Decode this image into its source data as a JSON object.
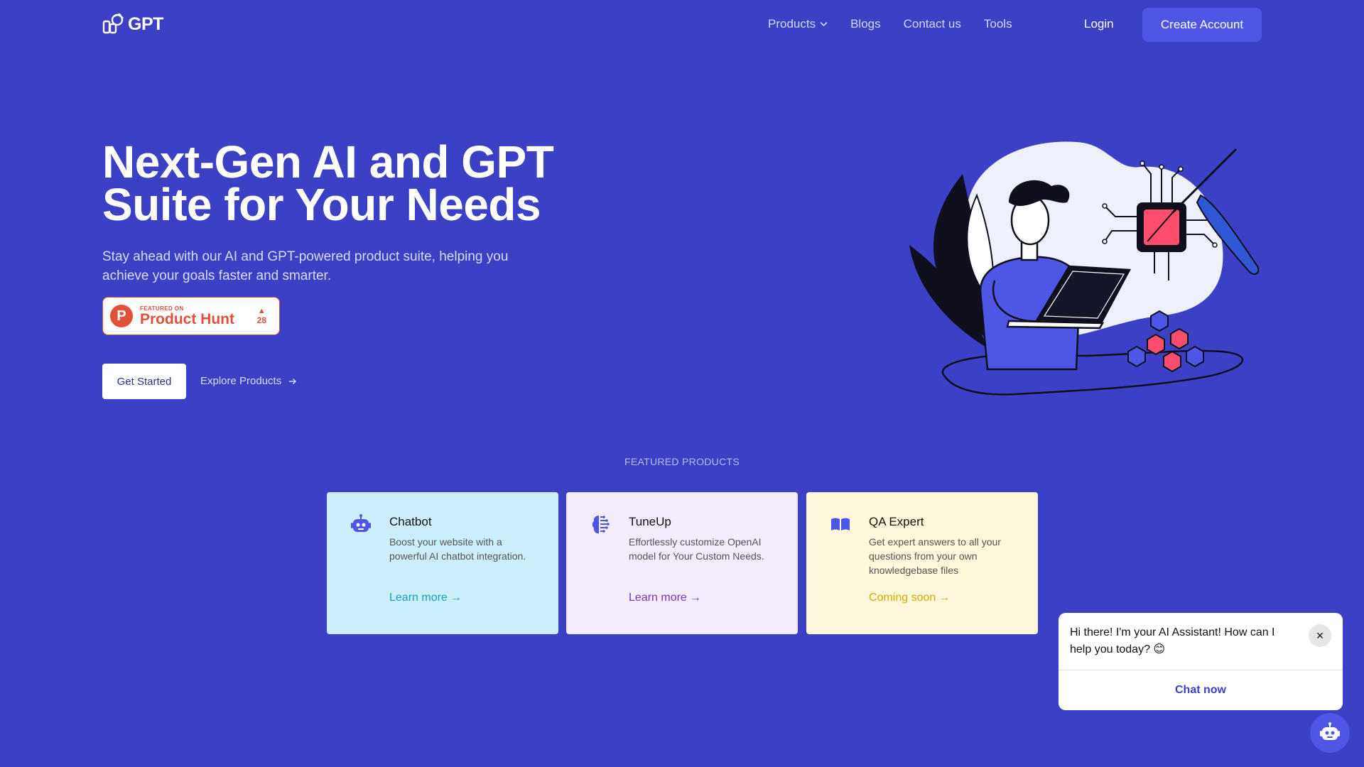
{
  "brand": {
    "logo_text": "GPT"
  },
  "nav": {
    "items": [
      {
        "label": "Products",
        "has_dropdown": true
      },
      {
        "label": "Blogs"
      },
      {
        "label": "Contact us"
      },
      {
        "label": "Tools"
      }
    ],
    "login_label": "Login",
    "create_account_label": "Create Account"
  },
  "hero": {
    "title_line_1": "Next-Gen AI and GPT",
    "title_line_2": "Suite for Your Needs",
    "subtitle": "Stay ahead with our AI and GPT-powered product suite, helping you achieve your goals faster and smarter.",
    "product_hunt": {
      "featured_on": "FEATURED ON",
      "name": "Product Hunt",
      "letter": "P",
      "votes": "28"
    },
    "get_started_label": "Get Started",
    "explore_label": "Explore Products"
  },
  "featured": {
    "label": "FEATURED PRODUCTS",
    "cards": [
      {
        "title": "Chatbot",
        "description": "Boost your website with a powerful AI chatbot integration.",
        "link": "Learn more",
        "link_color": "#1a9fc4",
        "icon": "robot-icon"
      },
      {
        "title": "TuneUp",
        "description": "Effortlessly customize OpenAI model for Your Custom Needs.",
        "link": "Learn more",
        "link_color": "#7b2fbf",
        "icon": "brain-icon"
      },
      {
        "title": "QA Expert",
        "description": "Get expert answers to all your questions from your own knowledgebase files",
        "link": "Coming soon",
        "link_color": "#d9a800",
        "icon": "book-icon"
      }
    ]
  },
  "chat": {
    "message": "Hi there! I'm your AI Assistant! How can I help you today? 😊",
    "cta": "Chat now",
    "close_icon": "×"
  },
  "colors": {
    "background": "#3b40c4",
    "accent": "#4f56e6",
    "product_hunt": "#e1503a"
  }
}
